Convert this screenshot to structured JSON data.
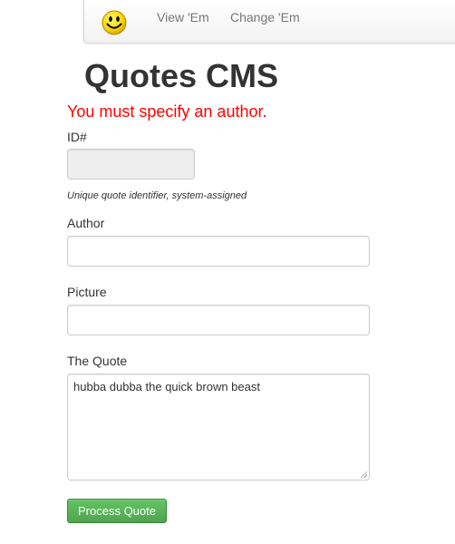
{
  "navbar": {
    "brand_icon": "smiley-icon",
    "links": [
      "View 'Em",
      "Change 'Em"
    ]
  },
  "page": {
    "title": "Quotes CMS",
    "error": "You must specify an author."
  },
  "form": {
    "id_label": "ID#",
    "id_value": "",
    "id_help": "Unique quote identifier, system-assigned",
    "author_label": "Author",
    "author_value": "",
    "picture_label": "Picture",
    "picture_value": "",
    "quote_label": "The Quote",
    "quote_value": "hubba dubba the quick brown beast",
    "submit_label": "Process Quote"
  },
  "colors": {
    "error": "#ff0000",
    "button": "#5bb75b",
    "nav_link": "#777777"
  }
}
